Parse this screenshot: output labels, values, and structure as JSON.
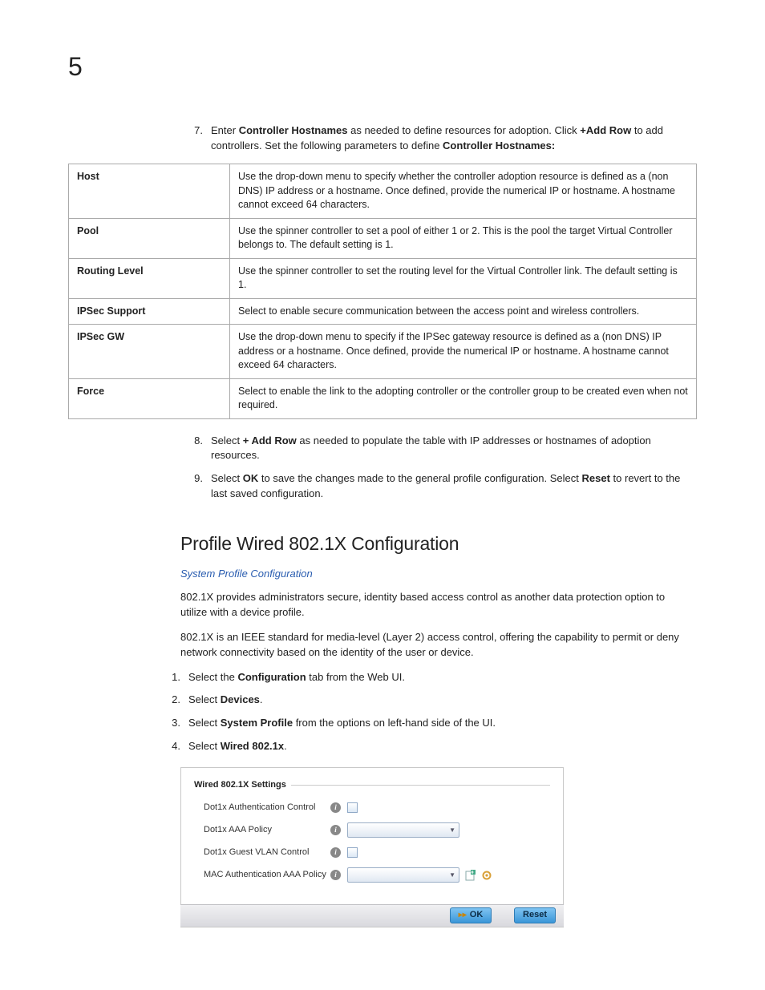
{
  "page_number": "5",
  "step7": {
    "num": "7.",
    "t_a": "Enter ",
    "t_b": "Controller Hostnames",
    "t_c": " as needed to define resources for adoption. Click ",
    "t_d": "+Add Row",
    "t_e": " to add controllers. Set the following parameters to define ",
    "t_f": "Controller Hostnames:"
  },
  "params_table": [
    {
      "label": "Host",
      "desc": "Use the drop-down menu to specify whether the controller adoption resource is defined as a (non DNS) IP address or a hostname. Once defined, provide the numerical IP or hostname. A hostname cannot exceed 64 characters."
    },
    {
      "label": "Pool",
      "desc": "Use the spinner controller to set a pool of either 1 or 2. This is the pool the target Virtual Controller belongs to. The default setting is 1."
    },
    {
      "label": "Routing Level",
      "desc": "Use the spinner controller to set the routing level for the Virtual Controller link. The default setting is 1."
    },
    {
      "label": "IPSec Support",
      "desc": "Select to enable secure communication between the access point and wireless controllers."
    },
    {
      "label": "IPSec GW",
      "desc": "Use the drop-down menu to specify if the IPSec gateway resource is defined as a (non DNS) IP address or a hostname. Once defined, provide the numerical IP or hostname. A hostname cannot exceed 64 characters."
    },
    {
      "label": "Force",
      "desc": "Select to enable the link to the adopting controller or the controller group to be created even when not required."
    }
  ],
  "step8": {
    "num": "8.",
    "t_a": "Select ",
    "t_b": "+ Add Row",
    "t_c": " as needed to populate the table with IP addresses or hostnames of adoption resources."
  },
  "step9": {
    "num": "9.",
    "t_a": "Select ",
    "t_b": "OK",
    "t_c": " to save the changes made to the general profile configuration. Select ",
    "t_d": "Reset",
    "t_e": " to revert to the last saved configuration."
  },
  "section_heading": "Profile Wired 802.1X Configuration",
  "breadcrumb_link": "System Profile Configuration",
  "intro_para1": "802.1X provides administrators secure, identity based access control as another data protection option to utilize with a device profile.",
  "intro_para2": "802.1X is an IEEE standard for media-level (Layer 2) access control, offering the capability to permit or deny network connectivity based on the identity of the user or device.",
  "cfg_steps": {
    "s1": {
      "num": "1.",
      "a": "Select the ",
      "b": "Configuration",
      "c": " tab from the Web UI."
    },
    "s2": {
      "num": "2.",
      "a": "Select ",
      "b": "Devices",
      "c": "."
    },
    "s3": {
      "num": "3.",
      "a": "Select ",
      "b": "System Profile",
      "c": " from the options on left-hand side of the UI."
    },
    "s4": {
      "num": "4.",
      "a": "Select ",
      "b": "Wired 802.1x",
      "c": "."
    }
  },
  "panel": {
    "fieldset_title": "Wired 802.1X Settings",
    "rows": {
      "auth_control": "Dot1x Authentication Control",
      "aaa_policy": "Dot1x AAA Policy",
      "guest_vlan": "Dot1x Guest VLAN Control",
      "mac_aaa": "MAC Authentication AAA Policy"
    },
    "ok_label": "OK",
    "reset_label": "Reset"
  }
}
